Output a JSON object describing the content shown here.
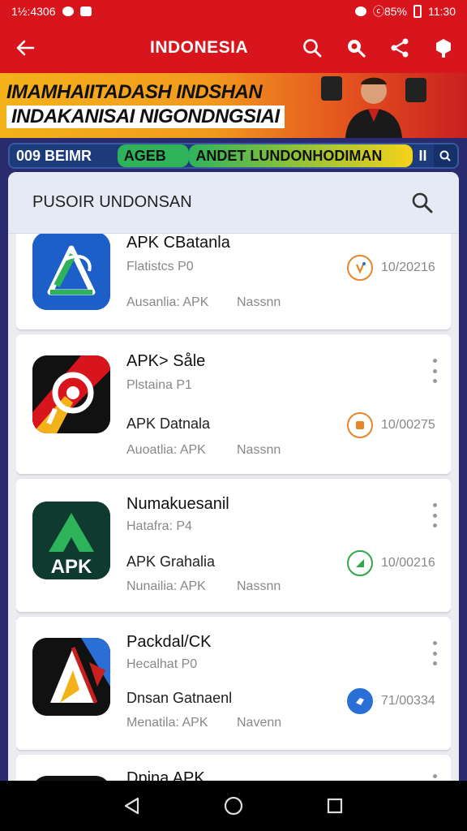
{
  "status_bar": {
    "left_text": "1½:4306",
    "right_text": "ⓒ85%",
    "time": "11:30"
  },
  "app_bar": {
    "title": "INDONESIA",
    "icons": [
      "back-arrow-icon",
      "search-icon",
      "search-filled-icon",
      "share-icon",
      "profile-icon"
    ]
  },
  "banner": {
    "line1": "IMAMHAIITADASH INDSHAN",
    "line2": "INDAKANISAI NIGONDNGSIAI"
  },
  "strip": {
    "seg1": "009 BEIMR",
    "seg2": "AGEB",
    "seg3": "ANDET LUNDONHODIMAN",
    "seg4": "II"
  },
  "search": {
    "label": "PUSOIR UNDONSAN"
  },
  "apps": [
    {
      "name": "APK CBatanla",
      "sub": "Flatistcs P0",
      "apk_line": "",
      "meta1": "Ausanlia: APK",
      "meta2": "Nassnn",
      "status_num": "10/20216",
      "status_color": "#e8852a"
    },
    {
      "name": "APK> Såle",
      "sub": "Plstaina P1",
      "apk_line": "APK Datnala",
      "meta1": "Auoatlia: APK",
      "meta2": "Nassnn",
      "status_num": "10/00275",
      "status_color": "#e8852a"
    },
    {
      "name": "Numakuesanil",
      "sub": "Hatafra: P4",
      "apk_line": "APK Grahalia",
      "meta1": "Nunailia: APK",
      "meta2": "Nassnn",
      "status_num": "10/00216",
      "status_color": "#2fa84a"
    },
    {
      "name": "Packdal/CK",
      "sub": "Hecalhat P0",
      "apk_line": "Dnsan Gatnaenl",
      "meta1": "Menatila: APK",
      "meta2": "Navenn",
      "status_num": "71/00334",
      "status_color": "#2a6fd6"
    },
    {
      "name": "Dpina APK",
      "sub": "",
      "apk_line": "",
      "meta1": "",
      "meta2": "",
      "status_num": "",
      "status_color": "#888888"
    }
  ],
  "apk_icon_text": "APK",
  "nav_bar": {
    "icons": [
      "back-triangle-icon",
      "home-circle-icon",
      "recents-square-icon"
    ]
  }
}
